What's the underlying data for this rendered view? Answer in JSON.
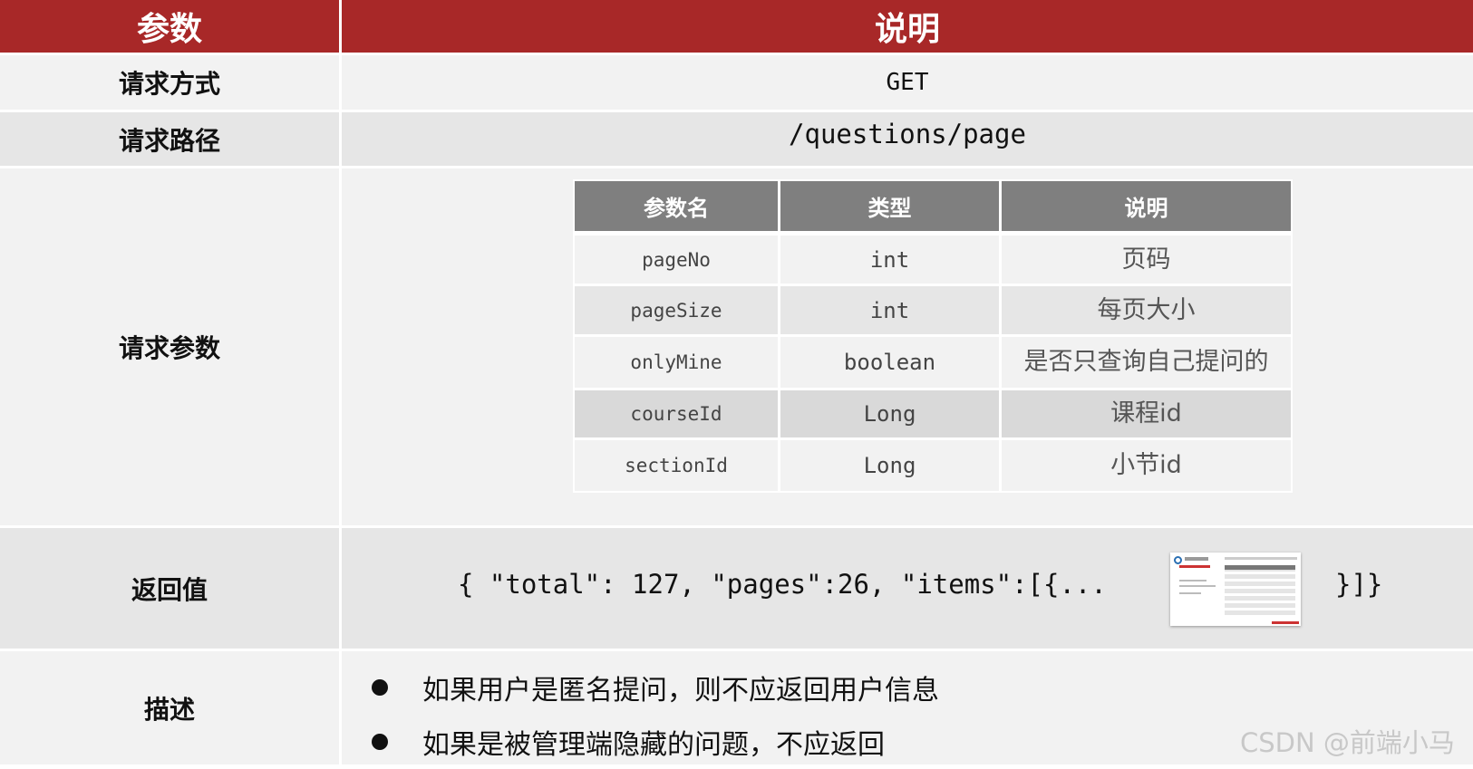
{
  "header": {
    "col_param": "参数",
    "col_desc": "说明"
  },
  "rows": {
    "method": {
      "label": "请求方式",
      "value": "GET"
    },
    "path": {
      "label": "请求路径",
      "value": "/questions/page"
    },
    "params": {
      "label": "请求参数",
      "table": {
        "headers": [
          "参数名",
          "类型",
          "说明"
        ],
        "rows": [
          {
            "name": "pageNo",
            "type": "int",
            "desc": "页码"
          },
          {
            "name": "pageSize",
            "type": "int",
            "desc": "每页大小"
          },
          {
            "name": "onlyMine",
            "type": "boolean",
            "desc": "是否只查询自己提问的"
          },
          {
            "name": "courseId",
            "type": "Long",
            "desc": "课程id"
          },
          {
            "name": "sectionId",
            "type": "Long",
            "desc": "小节id"
          }
        ]
      }
    },
    "return": {
      "label": "返回值",
      "value_start": "{ \"total\": 127, \"pages\":26, \"items\":[{...",
      "value_end": "}]}"
    },
    "description": {
      "label": "描述",
      "bullets": [
        "如果用户是匿名提问，则不应返回用户信息",
        "如果是被管理端隐藏的问题，不应返回"
      ]
    }
  },
  "watermark": "CSDN @前端小马"
}
